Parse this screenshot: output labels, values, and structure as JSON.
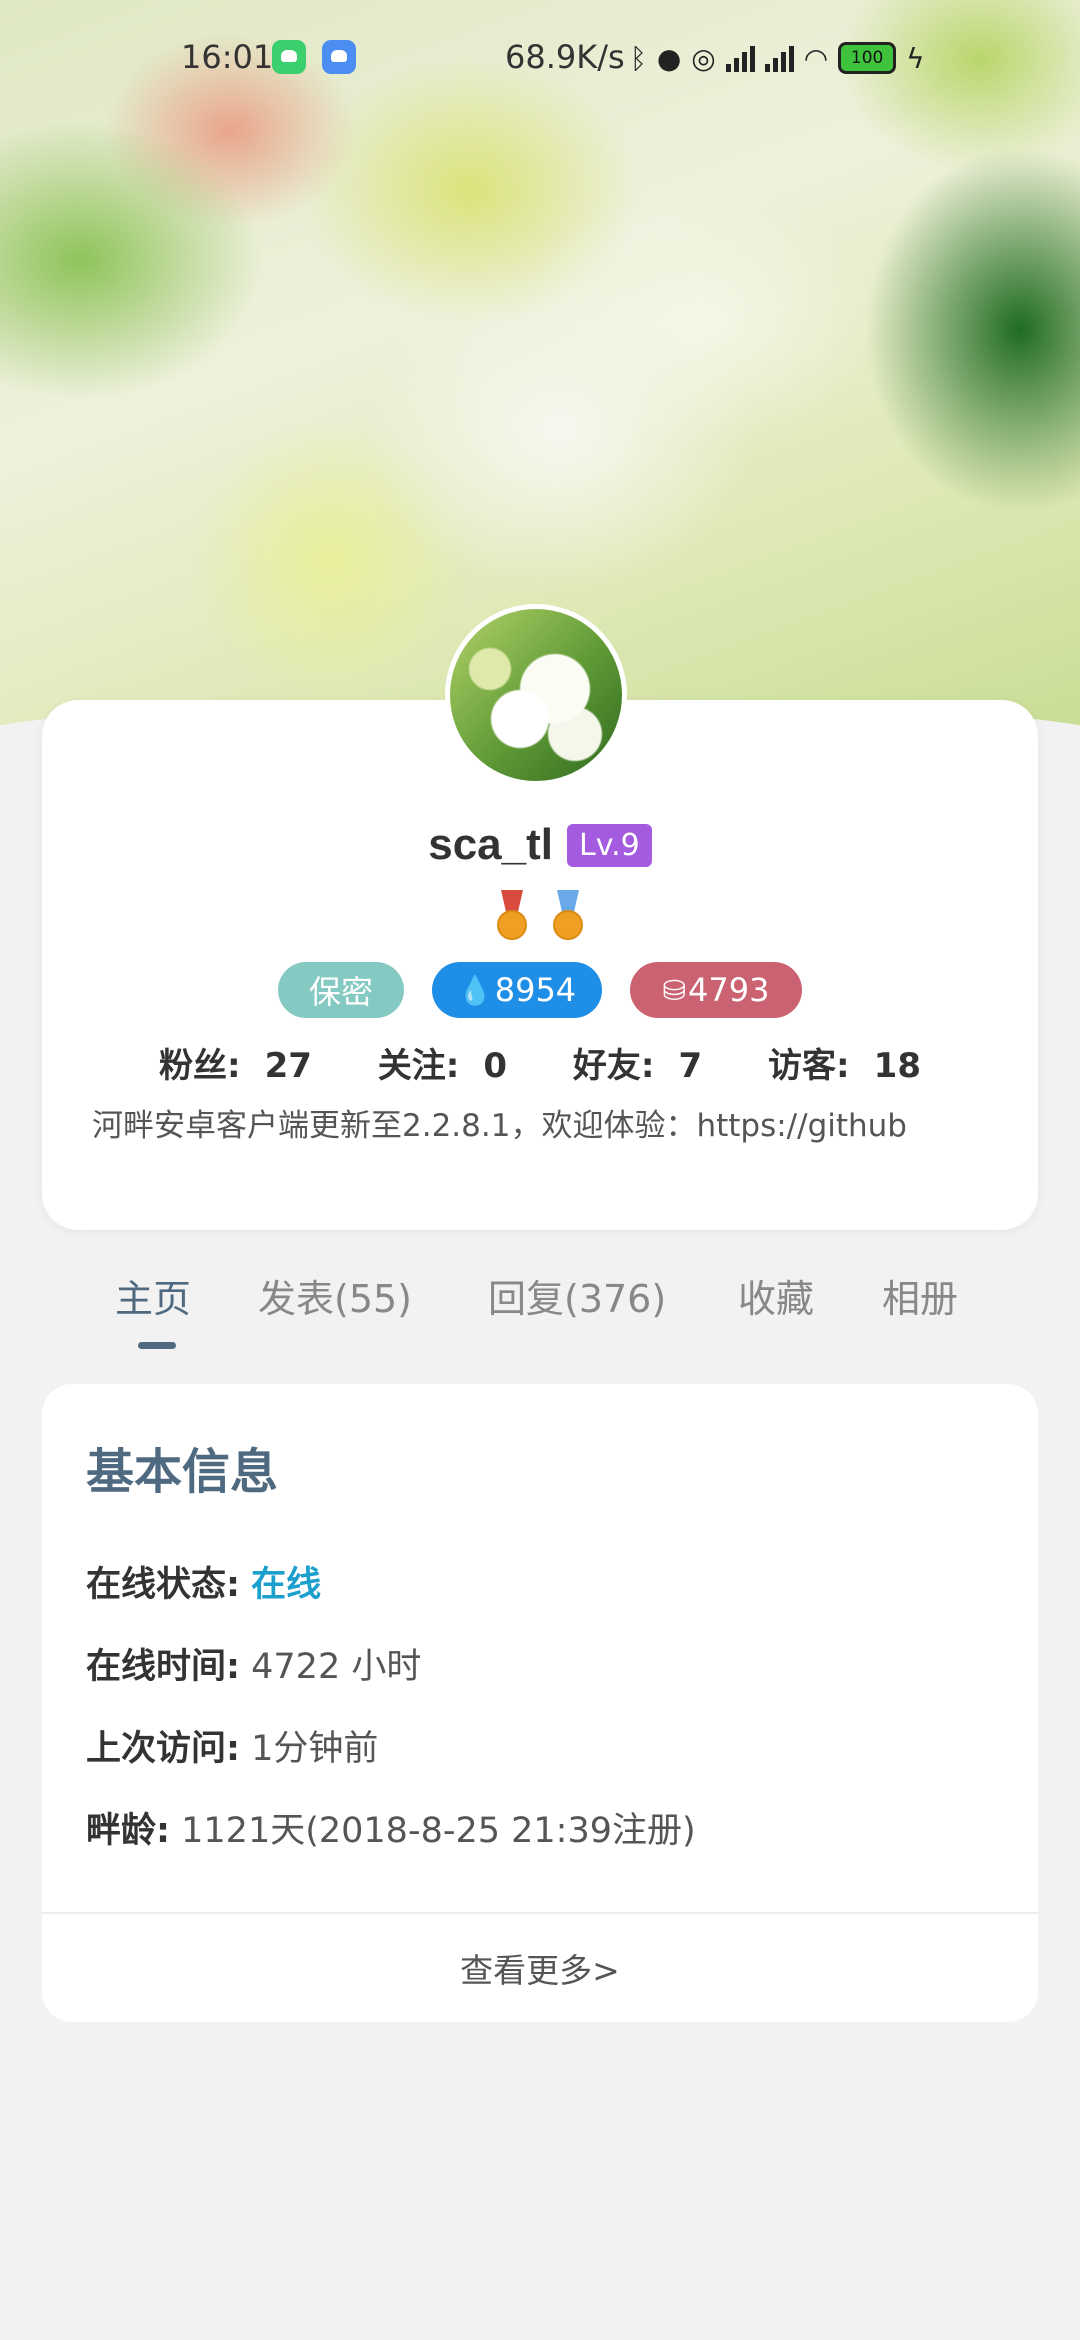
{
  "status_bar": {
    "time": "16:01",
    "net_speed": "68.9K/s",
    "battery": "100",
    "icons": [
      "wechat-icon",
      "android-app-icon",
      "bluetooth-icon",
      "qq-icon",
      "alarm-icon",
      "signal-icon",
      "signal-icon",
      "wifi-icon",
      "battery-icon",
      "charging-icon"
    ]
  },
  "profile": {
    "username": "sca_tl",
    "level": "Lv.9",
    "medals": [
      "medal-icon",
      "medal-icon"
    ],
    "tags": {
      "gender": "保密",
      "drops": "8954",
      "coins": "4793"
    },
    "stats": {
      "fans_label": "粉丝:",
      "fans": "27",
      "follow_label": "关注:",
      "follow": "0",
      "friends_label": "好友:",
      "friends": "7",
      "visitors_label": "访客:",
      "visitors": "18"
    },
    "signature": "河畔安卓客户端更新至2.2.8.1，欢迎体验：https://github"
  },
  "tabs": [
    {
      "label": "主页"
    },
    {
      "label": "发表(55)"
    },
    {
      "label": "回复(376)"
    },
    {
      "label": "收藏"
    },
    {
      "label": "相册"
    }
  ],
  "info": {
    "title": "基本信息",
    "online_status_label": "在线状态:",
    "online_status": "在线",
    "online_time_label": "在线时间:",
    "online_time": "4722 小时",
    "last_visit_label": "上次访问:",
    "last_visit": "1分钟前",
    "age_label": "畔龄:",
    "age": "1121天(2018-8-25 21:39注册)",
    "more": "查看更多>"
  },
  "colors": {
    "accent": "#4f6a80",
    "level_badge": "#a45be0",
    "tag_secret": "#84c9c2",
    "tag_drop": "#1f8ee6",
    "tag_coin": "#cb6271",
    "online": "#1b9fcc"
  }
}
